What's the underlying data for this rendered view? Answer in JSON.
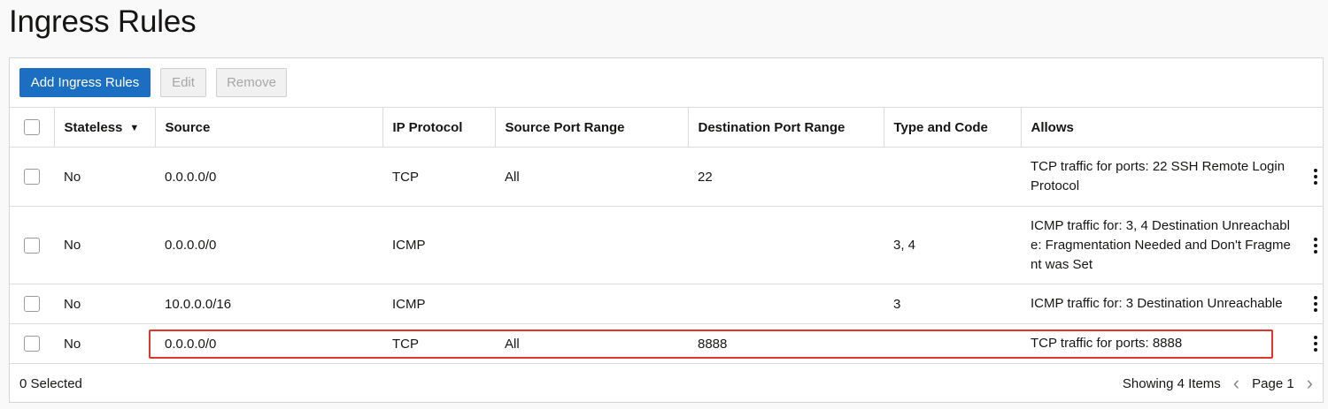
{
  "page": {
    "title": "Ingress Rules"
  },
  "toolbar": {
    "add_label": "Add Ingress Rules",
    "edit_label": "Edit",
    "remove_label": "Remove"
  },
  "table": {
    "columns": [
      "Stateless",
      "Source",
      "IP Protocol",
      "Source Port Range",
      "Destination Port Range",
      "Type and Code",
      "Allows"
    ],
    "rows": [
      {
        "stateless": "No",
        "source": "0.0.0.0/0",
        "protocol": "TCP",
        "src_port": "All",
        "dst_port": "22",
        "type_code": "",
        "allows": "TCP traffic for ports: 22 SSH Remote Login Protocol"
      },
      {
        "stateless": "No",
        "source": "0.0.0.0/0",
        "protocol": "ICMP",
        "src_port": "",
        "dst_port": "",
        "type_code": "3, 4",
        "allows": "ICMP traffic for: 3, 4 Destination Unreachable: Fragmentation Needed and Don't Fragment was Set"
      },
      {
        "stateless": "No",
        "source": "10.0.0.0/16",
        "protocol": "ICMP",
        "src_port": "",
        "dst_port": "",
        "type_code": "3",
        "allows": "ICMP traffic for: 3 Destination Unreachable"
      },
      {
        "stateless": "No",
        "source": "0.0.0.0/0",
        "protocol": "TCP",
        "src_port": "All",
        "dst_port": "8888",
        "type_code": "",
        "allows": "TCP traffic for ports: 8888"
      }
    ]
  },
  "footer": {
    "selected": "0 Selected",
    "showing": "Showing 4 Items",
    "page": "Page 1"
  },
  "colors": {
    "primary": "#1b6ec2",
    "highlight": "#e0362d"
  },
  "icons": {
    "sort": "caret-down-icon",
    "row_menu": "kebab-menu-icon",
    "prev": "chevron-left-icon",
    "next": "chevron-right-icon"
  }
}
